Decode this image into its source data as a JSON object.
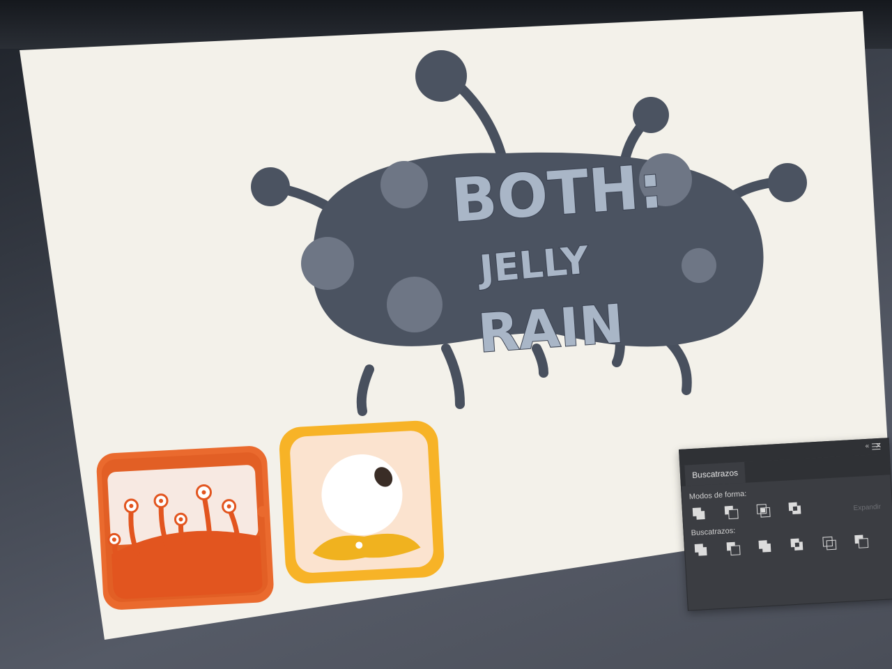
{
  "logo": {
    "line1": "BOTH:",
    "line2": "JELLY",
    "line3": "RAIN"
  },
  "colors": {
    "artboard": "#f3f1ea",
    "creature_body": "#4b5361",
    "creature_spots": "#6e7685",
    "creature_limbs": "#48505e",
    "logo_text": "#a9b6c7",
    "icon1_orange": "#ea6a2e",
    "icon1_inner": "#f7e9e2",
    "icon2_yellow": "#f7b327",
    "icon2_inner": "#fbe3cf",
    "eye_yolk": "#f0b21f",
    "panel_bg": "#3b3d42"
  },
  "panel": {
    "title": "Buscatrazos",
    "collapse_icon": "«",
    "close_icon": "✕",
    "menu_icon": "hamburger-icon",
    "shape_modes_label": "Modos de forma:",
    "expand_label": "Expandir",
    "pathfinders_label": "Buscatrazos:",
    "shape_modes": [
      "unite",
      "minus-front",
      "intersect",
      "exclude"
    ],
    "pathfinders": [
      "divide",
      "trim",
      "merge",
      "crop",
      "outline",
      "minus-back"
    ]
  }
}
